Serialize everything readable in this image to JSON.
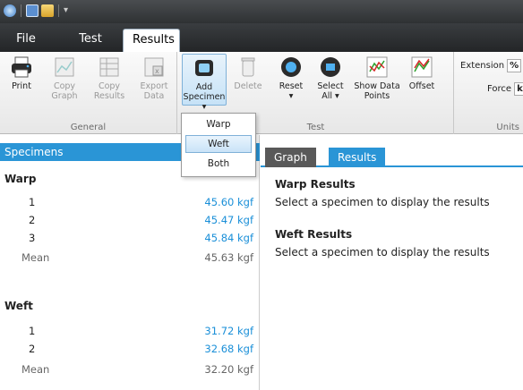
{
  "app": {
    "tabs": [
      "File",
      "Test",
      "Results"
    ],
    "active_tab": "Results"
  },
  "ribbon": {
    "general": {
      "label": "General",
      "buttons": [
        {
          "label1": "Print",
          "label2": "",
          "icon": "printer-icon",
          "enabled": true
        },
        {
          "label1": "Copy",
          "label2": "Graph",
          "icon": "copy-graph-icon",
          "enabled": false
        },
        {
          "label1": "Copy",
          "label2": "Results",
          "icon": "copy-results-icon",
          "enabled": false
        },
        {
          "label1": "Export",
          "label2": "Data",
          "icon": "export-data-icon",
          "enabled": false
        }
      ]
    },
    "test": {
      "label": "Test",
      "buttons": [
        {
          "label1": "Add",
          "label2": "Specimen ▾",
          "icon": "add-specimen-icon",
          "enabled": true,
          "active": true
        },
        {
          "label1": "Delete",
          "label2": "",
          "icon": "delete-icon",
          "enabled": false
        },
        {
          "label1": "Reset",
          "label2": "▾",
          "icon": "reset-icon",
          "enabled": true
        },
        {
          "label1": "Select",
          "label2": "All ▾",
          "icon": "select-all-icon",
          "enabled": true
        },
        {
          "label1": "Show Data",
          "label2": "Points",
          "icon": "show-data-points-icon",
          "enabled": true
        },
        {
          "label1": "Offset",
          "label2": "",
          "icon": "offset-icon",
          "enabled": true
        }
      ]
    },
    "units": {
      "label": "Units",
      "extension_label": "Extension",
      "extension_value": "%",
      "force_label": "Force",
      "force_value": "kgf"
    }
  },
  "dropdown": {
    "items": [
      "Warp",
      "Weft",
      "Both"
    ],
    "selected": "Weft"
  },
  "specimens": {
    "header": "Specimens",
    "warp": {
      "title": "Warp",
      "rows": [
        {
          "label": "1",
          "value": "45.60 kgf"
        },
        {
          "label": "2",
          "value": "45.47 kgf"
        },
        {
          "label": "3",
          "value": "45.84 kgf"
        }
      ],
      "mean_label": "Mean",
      "mean_value": "45.63 kgf"
    },
    "weft": {
      "title": "Weft",
      "rows": [
        {
          "label": "1",
          "value": "31.72 kgf"
        },
        {
          "label": "2",
          "value": "32.68 kgf"
        }
      ],
      "mean_label": "Mean",
      "mean_value": "32.20 kgf"
    }
  },
  "results_panel": {
    "tabs": [
      "Graph",
      "Results"
    ],
    "active_tab": "Results",
    "warp_title": "Warp Results",
    "warp_text": "Select a specimen to display the results",
    "weft_title": "Weft Results",
    "weft_text": "Select a specimen to display the results"
  },
  "colors": {
    "accent": "#2a95d6",
    "value_text": "#1a8fd8"
  }
}
